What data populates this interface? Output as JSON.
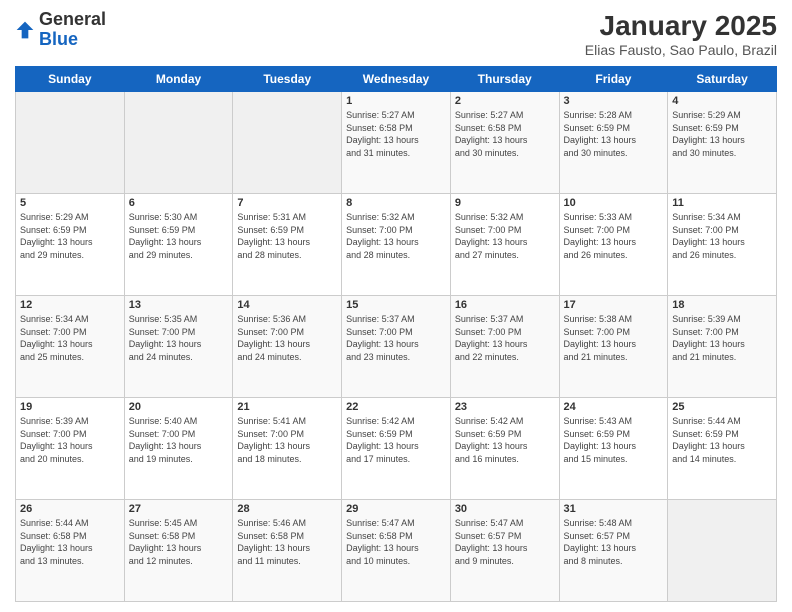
{
  "logo": {
    "general": "General",
    "blue": "Blue"
  },
  "header": {
    "title": "January 2025",
    "subtitle": "Elias Fausto, Sao Paulo, Brazil"
  },
  "days_of_week": [
    "Sunday",
    "Monday",
    "Tuesday",
    "Wednesday",
    "Thursday",
    "Friday",
    "Saturday"
  ],
  "weeks": [
    {
      "days": [
        {
          "num": "",
          "info": "",
          "empty": true
        },
        {
          "num": "",
          "info": "",
          "empty": true
        },
        {
          "num": "",
          "info": "",
          "empty": true
        },
        {
          "num": "1",
          "info": "Sunrise: 5:27 AM\nSunset: 6:58 PM\nDaylight: 13 hours\nand 31 minutes.",
          "empty": false
        },
        {
          "num": "2",
          "info": "Sunrise: 5:27 AM\nSunset: 6:58 PM\nDaylight: 13 hours\nand 30 minutes.",
          "empty": false
        },
        {
          "num": "3",
          "info": "Sunrise: 5:28 AM\nSunset: 6:59 PM\nDaylight: 13 hours\nand 30 minutes.",
          "empty": false
        },
        {
          "num": "4",
          "info": "Sunrise: 5:29 AM\nSunset: 6:59 PM\nDaylight: 13 hours\nand 30 minutes.",
          "empty": false
        }
      ]
    },
    {
      "days": [
        {
          "num": "5",
          "info": "Sunrise: 5:29 AM\nSunset: 6:59 PM\nDaylight: 13 hours\nand 29 minutes.",
          "empty": false
        },
        {
          "num": "6",
          "info": "Sunrise: 5:30 AM\nSunset: 6:59 PM\nDaylight: 13 hours\nand 29 minutes.",
          "empty": false
        },
        {
          "num": "7",
          "info": "Sunrise: 5:31 AM\nSunset: 6:59 PM\nDaylight: 13 hours\nand 28 minutes.",
          "empty": false
        },
        {
          "num": "8",
          "info": "Sunrise: 5:32 AM\nSunset: 7:00 PM\nDaylight: 13 hours\nand 28 minutes.",
          "empty": false
        },
        {
          "num": "9",
          "info": "Sunrise: 5:32 AM\nSunset: 7:00 PM\nDaylight: 13 hours\nand 27 minutes.",
          "empty": false
        },
        {
          "num": "10",
          "info": "Sunrise: 5:33 AM\nSunset: 7:00 PM\nDaylight: 13 hours\nand 26 minutes.",
          "empty": false
        },
        {
          "num": "11",
          "info": "Sunrise: 5:34 AM\nSunset: 7:00 PM\nDaylight: 13 hours\nand 26 minutes.",
          "empty": false
        }
      ]
    },
    {
      "days": [
        {
          "num": "12",
          "info": "Sunrise: 5:34 AM\nSunset: 7:00 PM\nDaylight: 13 hours\nand 25 minutes.",
          "empty": false
        },
        {
          "num": "13",
          "info": "Sunrise: 5:35 AM\nSunset: 7:00 PM\nDaylight: 13 hours\nand 24 minutes.",
          "empty": false
        },
        {
          "num": "14",
          "info": "Sunrise: 5:36 AM\nSunset: 7:00 PM\nDaylight: 13 hours\nand 24 minutes.",
          "empty": false
        },
        {
          "num": "15",
          "info": "Sunrise: 5:37 AM\nSunset: 7:00 PM\nDaylight: 13 hours\nand 23 minutes.",
          "empty": false
        },
        {
          "num": "16",
          "info": "Sunrise: 5:37 AM\nSunset: 7:00 PM\nDaylight: 13 hours\nand 22 minutes.",
          "empty": false
        },
        {
          "num": "17",
          "info": "Sunrise: 5:38 AM\nSunset: 7:00 PM\nDaylight: 13 hours\nand 21 minutes.",
          "empty": false
        },
        {
          "num": "18",
          "info": "Sunrise: 5:39 AM\nSunset: 7:00 PM\nDaylight: 13 hours\nand 21 minutes.",
          "empty": false
        }
      ]
    },
    {
      "days": [
        {
          "num": "19",
          "info": "Sunrise: 5:39 AM\nSunset: 7:00 PM\nDaylight: 13 hours\nand 20 minutes.",
          "empty": false
        },
        {
          "num": "20",
          "info": "Sunrise: 5:40 AM\nSunset: 7:00 PM\nDaylight: 13 hours\nand 19 minutes.",
          "empty": false
        },
        {
          "num": "21",
          "info": "Sunrise: 5:41 AM\nSunset: 7:00 PM\nDaylight: 13 hours\nand 18 minutes.",
          "empty": false
        },
        {
          "num": "22",
          "info": "Sunrise: 5:42 AM\nSunset: 6:59 PM\nDaylight: 13 hours\nand 17 minutes.",
          "empty": false
        },
        {
          "num": "23",
          "info": "Sunrise: 5:42 AM\nSunset: 6:59 PM\nDaylight: 13 hours\nand 16 minutes.",
          "empty": false
        },
        {
          "num": "24",
          "info": "Sunrise: 5:43 AM\nSunset: 6:59 PM\nDaylight: 13 hours\nand 15 minutes.",
          "empty": false
        },
        {
          "num": "25",
          "info": "Sunrise: 5:44 AM\nSunset: 6:59 PM\nDaylight: 13 hours\nand 14 minutes.",
          "empty": false
        }
      ]
    },
    {
      "days": [
        {
          "num": "26",
          "info": "Sunrise: 5:44 AM\nSunset: 6:58 PM\nDaylight: 13 hours\nand 13 minutes.",
          "empty": false
        },
        {
          "num": "27",
          "info": "Sunrise: 5:45 AM\nSunset: 6:58 PM\nDaylight: 13 hours\nand 12 minutes.",
          "empty": false
        },
        {
          "num": "28",
          "info": "Sunrise: 5:46 AM\nSunset: 6:58 PM\nDaylight: 13 hours\nand 11 minutes.",
          "empty": false
        },
        {
          "num": "29",
          "info": "Sunrise: 5:47 AM\nSunset: 6:58 PM\nDaylight: 13 hours\nand 10 minutes.",
          "empty": false
        },
        {
          "num": "30",
          "info": "Sunrise: 5:47 AM\nSunset: 6:57 PM\nDaylight: 13 hours\nand 9 minutes.",
          "empty": false
        },
        {
          "num": "31",
          "info": "Sunrise: 5:48 AM\nSunset: 6:57 PM\nDaylight: 13 hours\nand 8 minutes.",
          "empty": false
        },
        {
          "num": "",
          "info": "",
          "empty": true
        }
      ]
    }
  ]
}
